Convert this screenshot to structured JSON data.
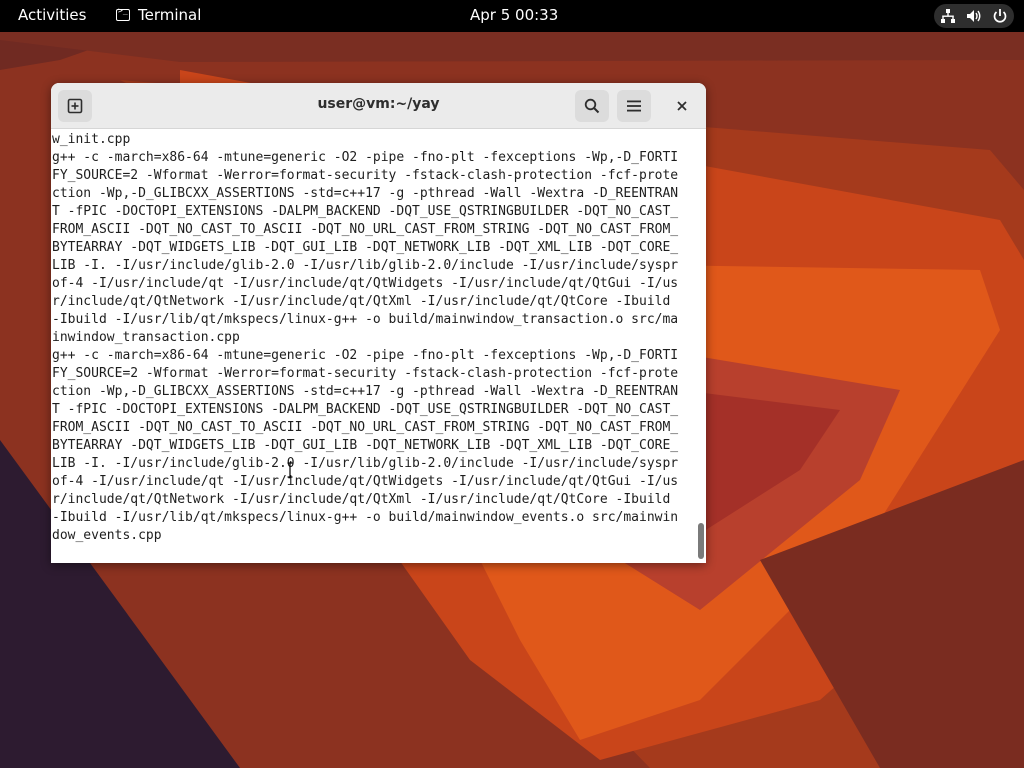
{
  "topbar": {
    "activities_label": "Activities",
    "app_label": "Terminal",
    "clock": "Apr 5  00:33",
    "tray_icons": [
      "network-icon",
      "volume-icon",
      "power-icon"
    ]
  },
  "window": {
    "title": "user@vm:~/yay",
    "buttons": [
      "new-tab-icon",
      "search-icon",
      "hamburger-menu-icon",
      "close-icon"
    ]
  },
  "terminal": {
    "lines": [
      "w_init.cpp",
      "g++ -c -march=x86-64 -mtune=generic -O2 -pipe -fno-plt -fexceptions -Wp,-D_FORTI",
      "FY_SOURCE=2 -Wformat -Werror=format-security -fstack-clash-protection -fcf-prote",
      "ction -Wp,-D_GLIBCXX_ASSERTIONS -std=c++17 -g -pthread -Wall -Wextra -D_REENTRAN",
      "T -fPIC -DOCTOPI_EXTENSIONS -DALPM_BACKEND -DQT_USE_QSTRINGBUILDER -DQT_NO_CAST_",
      "FROM_ASCII -DQT_NO_CAST_TO_ASCII -DQT_NO_URL_CAST_FROM_STRING -DQT_NO_CAST_FROM_",
      "BYTEARRAY -DQT_WIDGETS_LIB -DQT_GUI_LIB -DQT_NETWORK_LIB -DQT_XML_LIB -DQT_CORE_",
      "LIB -I. -I/usr/include/glib-2.0 -I/usr/lib/glib-2.0/include -I/usr/include/syspr",
      "of-4 -I/usr/include/qt -I/usr/include/qt/QtWidgets -I/usr/include/qt/QtGui -I/us",
      "r/include/qt/QtNetwork -I/usr/include/qt/QtXml -I/usr/include/qt/QtCore -Ibuild",
      "-Ibuild -I/usr/lib/qt/mkspecs/linux-g++ -o build/mainwindow_transaction.o src/ma",
      "inwindow_transaction.cpp",
      "g++ -c -march=x86-64 -mtune=generic -O2 -pipe -fno-plt -fexceptions -Wp,-D_FORTI",
      "FY_SOURCE=2 -Wformat -Werror=format-security -fstack-clash-protection -fcf-prote",
      "ction -Wp,-D_GLIBCXX_ASSERTIONS -std=c++17 -g -pthread -Wall -Wextra -D_REENTRAN",
      "T -fPIC -DOCTOPI_EXTENSIONS -DALPM_BACKEND -DQT_USE_QSTRINGBUILDER -DQT_NO_CAST_",
      "FROM_ASCII -DQT_NO_CAST_TO_ASCII -DQT_NO_URL_CAST_FROM_STRING -DQT_NO_CAST_FROM_",
      "BYTEARRAY -DQT_WIDGETS_LIB -DQT_GUI_LIB -DQT_NETWORK_LIB -DQT_XML_LIB -DQT_CORE_",
      "LIB -I. -I/usr/include/glib-2.0 -I/usr/lib/glib-2.0/include -I/usr/include/syspr",
      "of-4 -I/usr/include/qt -I/usr/include/qt/QtWidgets -I/usr/include/qt/QtGui -I/us",
      "r/include/qt/QtNetwork -I/usr/include/qt/QtXml -I/usr/include/qt/QtCore -Ibuild",
      "-Ibuild -I/usr/lib/qt/mkspecs/linux-g++ -o build/mainwindow_events.o src/mainwin",
      "dow_events.cpp"
    ]
  },
  "colors": {
    "topbar_bg": "#000000",
    "headerbar_bg": "#ebebeb",
    "terminal_bg": "#ffffff",
    "terminal_fg": "#1e1e1e",
    "wallpaper_dark": "#3a1e2e",
    "wallpaper_orange": "#e0581a"
  }
}
